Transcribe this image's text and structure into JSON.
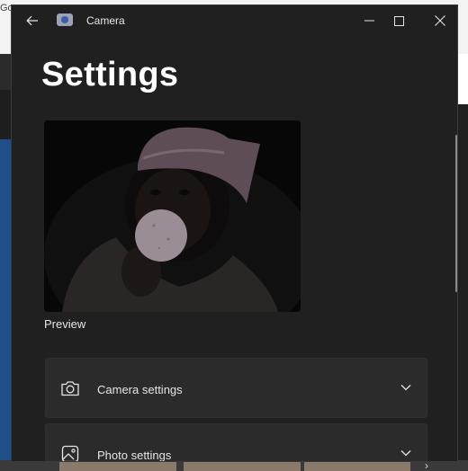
{
  "background": {
    "top_text": "Go"
  },
  "window": {
    "title": "Camera"
  },
  "page": {
    "heading": "Settings",
    "preview_label": "Preview"
  },
  "sections": [
    {
      "label": "Camera settings",
      "icon": "camera-icon"
    },
    {
      "label": "Photo settings",
      "icon": "image-icon"
    }
  ],
  "colors": {
    "window_bg": "#202020",
    "card_bg": "#2b2b2b",
    "text": "#e6e6e6"
  }
}
